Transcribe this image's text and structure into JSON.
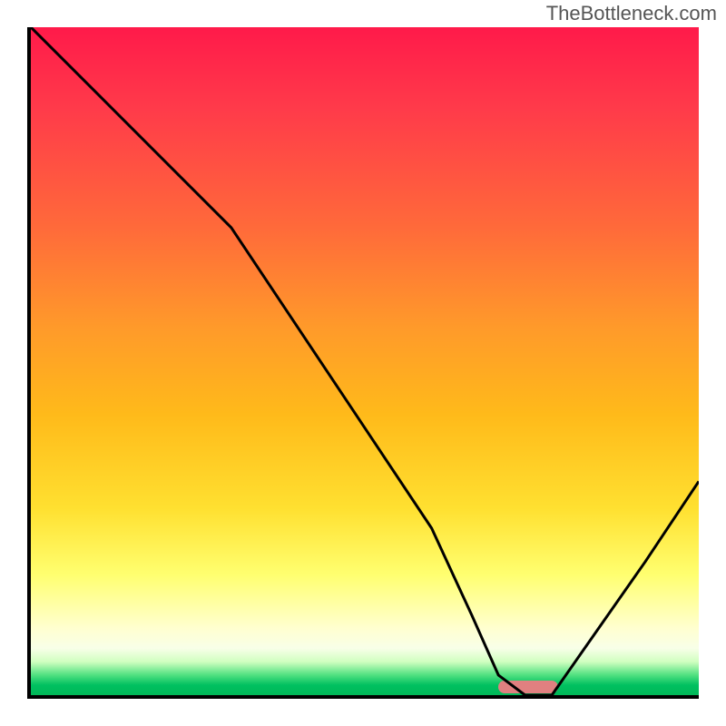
{
  "watermark": "TheBottleneck.com",
  "chart_data": {
    "type": "line",
    "title": "",
    "xlabel": "",
    "ylabel": "",
    "xlim": [
      0,
      100
    ],
    "ylim": [
      0,
      100
    ],
    "x": [
      0,
      10,
      23,
      30,
      40,
      50,
      60,
      66,
      70,
      74,
      78,
      85,
      92,
      100
    ],
    "values": [
      100,
      90,
      77,
      70,
      55,
      40,
      25,
      12,
      3,
      0,
      0,
      10,
      20,
      32
    ],
    "valley_marker": {
      "x_start": 70,
      "x_end": 79,
      "y": 0
    },
    "gradient_stops": [
      {
        "pos": 0,
        "color": "#ff1a4a"
      },
      {
        "pos": 12,
        "color": "#ff3a4a"
      },
      {
        "pos": 30,
        "color": "#ff6a3a"
      },
      {
        "pos": 45,
        "color": "#ff9a2a"
      },
      {
        "pos": 58,
        "color": "#ffba1a"
      },
      {
        "pos": 72,
        "color": "#ffe030"
      },
      {
        "pos": 82,
        "color": "#ffff70"
      },
      {
        "pos": 90,
        "color": "#ffffd0"
      },
      {
        "pos": 93,
        "color": "#f8ffe8"
      },
      {
        "pos": 95,
        "color": "#d0ffc0"
      },
      {
        "pos": 97,
        "color": "#50e080"
      },
      {
        "pos": 98.5,
        "color": "#00c060"
      },
      {
        "pos": 100,
        "color": "#00b858"
      }
    ]
  }
}
